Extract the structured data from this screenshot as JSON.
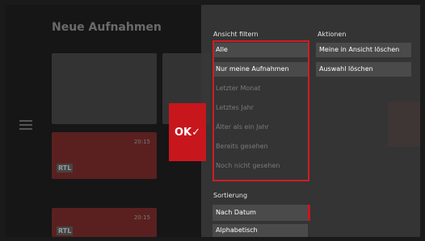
{
  "background": {
    "title": "Neue Aufnahmen",
    "tiles": [
      {
        "badge": "RTL",
        "time": "20:15"
      },
      {
        "badge": "RTL",
        "time": "20:15"
      }
    ]
  },
  "ok_key": {
    "label": "OK✓"
  },
  "filter": {
    "heading": "Ansicht filtern",
    "items": [
      {
        "label": "Alle",
        "state": "highlighted"
      },
      {
        "label": "Nur meine Aufnahmen",
        "state": "highlighted"
      },
      {
        "label": "Letzter Monat",
        "state": "disabled"
      },
      {
        "label": "Letztes Jahr",
        "state": "disabled"
      },
      {
        "label": "Älter als ein Jahr",
        "state": "disabled"
      },
      {
        "label": "Bereits gesehen",
        "state": "disabled"
      },
      {
        "label": "Noch nicht gesehen",
        "state": "disabled"
      }
    ]
  },
  "actions": {
    "heading": "Aktionen",
    "items": [
      {
        "label": "Meine in Ansicht löschen"
      },
      {
        "label": "Auswahl löschen"
      }
    ]
  },
  "sort": {
    "heading": "Sortierung",
    "items": [
      {
        "label": "Nach Datum",
        "selected": true
      },
      {
        "label": "Alphabetisch",
        "selected": false
      }
    ]
  },
  "colors": {
    "accent": "#c8161d",
    "panel": "#373737"
  }
}
